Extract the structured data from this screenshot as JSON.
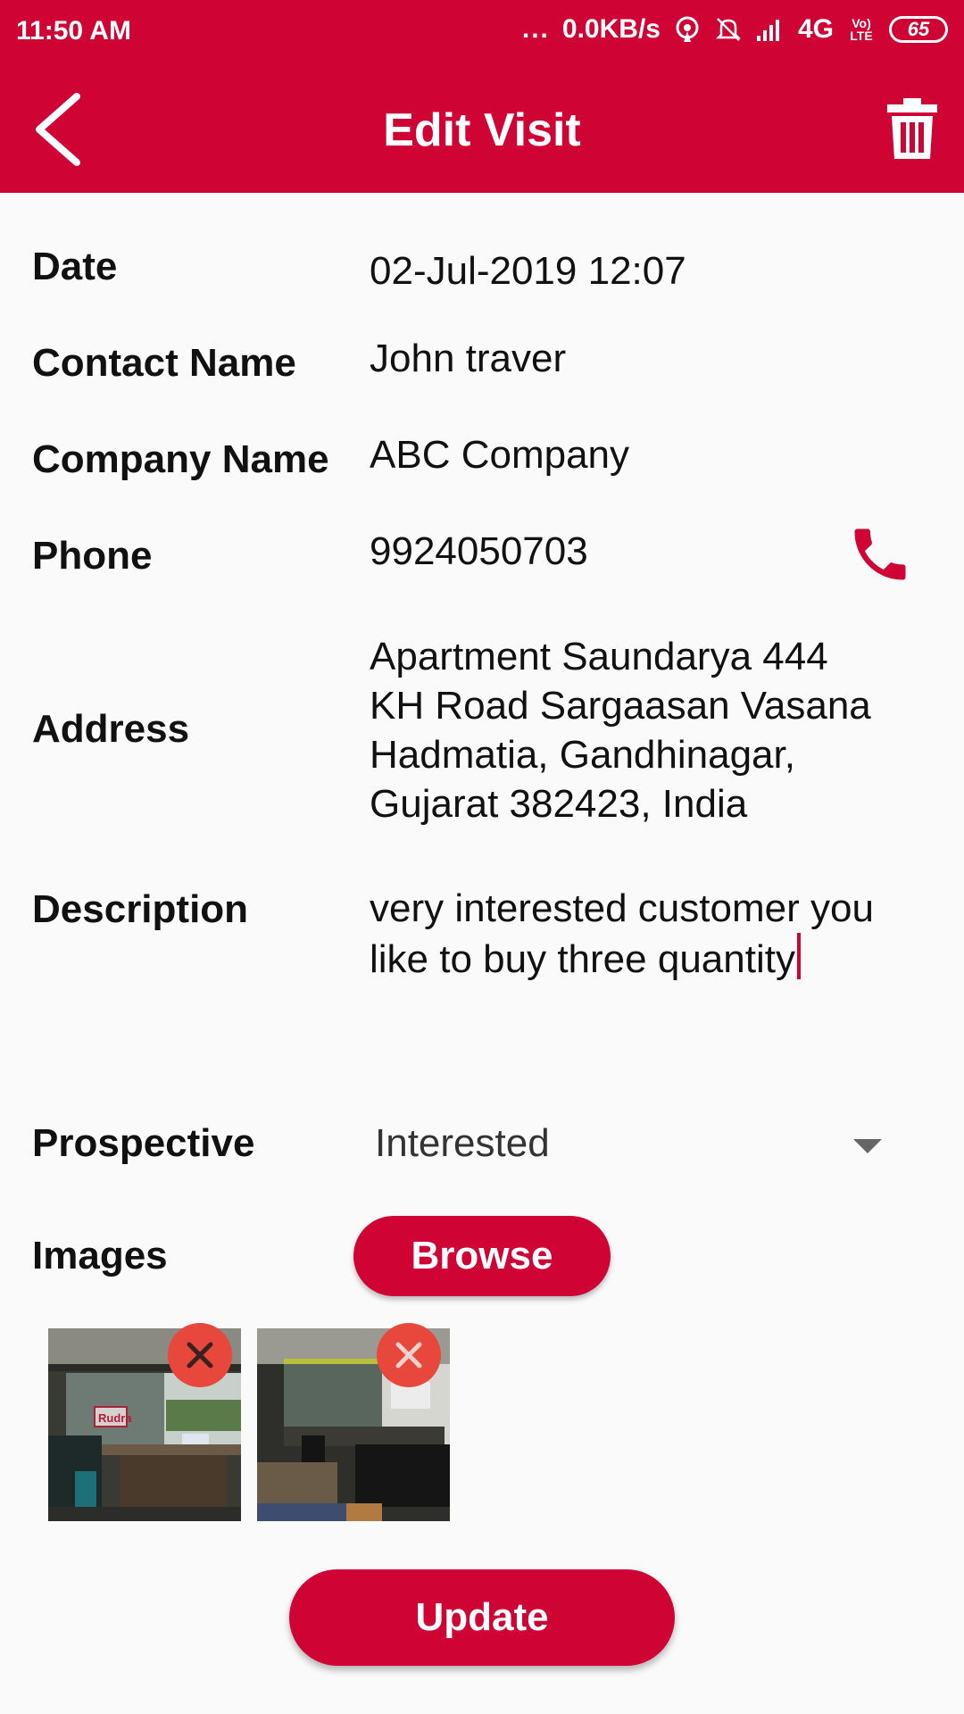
{
  "status_bar": {
    "time": "11:50 AM",
    "dots": "...",
    "network_speed": "0.0KB/s",
    "network_type": "4G",
    "volte": "Vo) LTE",
    "battery": "65"
  },
  "app_bar": {
    "title": "Edit Visit",
    "back_icon": "chevron-left-icon",
    "delete_icon": "trash-icon"
  },
  "form": {
    "date": {
      "label": "Date",
      "value": "02-Jul-2019 12:07"
    },
    "contact_name": {
      "label": "Contact Name",
      "value": "John traver"
    },
    "company_name": {
      "label": "Company Name",
      "value": "ABC Company"
    },
    "phone": {
      "label": "Phone",
      "value": "9924050703",
      "icon": "phone-icon"
    },
    "address": {
      "label": "Address",
      "lines": [
        "Apartment Saundarya 444",
        "KH Road Sargaasan Vasana",
        "Hadmatia, Gandhinagar,",
        "Gujarat 382423, India"
      ]
    },
    "description": {
      "label": "Description",
      "lines": [
        "very interested customer you",
        "like to buy three quantity"
      ]
    },
    "prospective": {
      "label": "Prospective",
      "selected": "Interested"
    },
    "images": {
      "label": "Images",
      "browse_label": "Browse",
      "thumbnails": [
        {
          "caption": "Rudra",
          "remove_icon": "close-icon"
        },
        {
          "caption": "",
          "remove_icon": "close-icon"
        }
      ]
    }
  },
  "actions": {
    "update_label": "Update"
  },
  "colors": {
    "primary": "#cf0435",
    "remove_badge": "#e8473b",
    "background": "#fafafa"
  }
}
